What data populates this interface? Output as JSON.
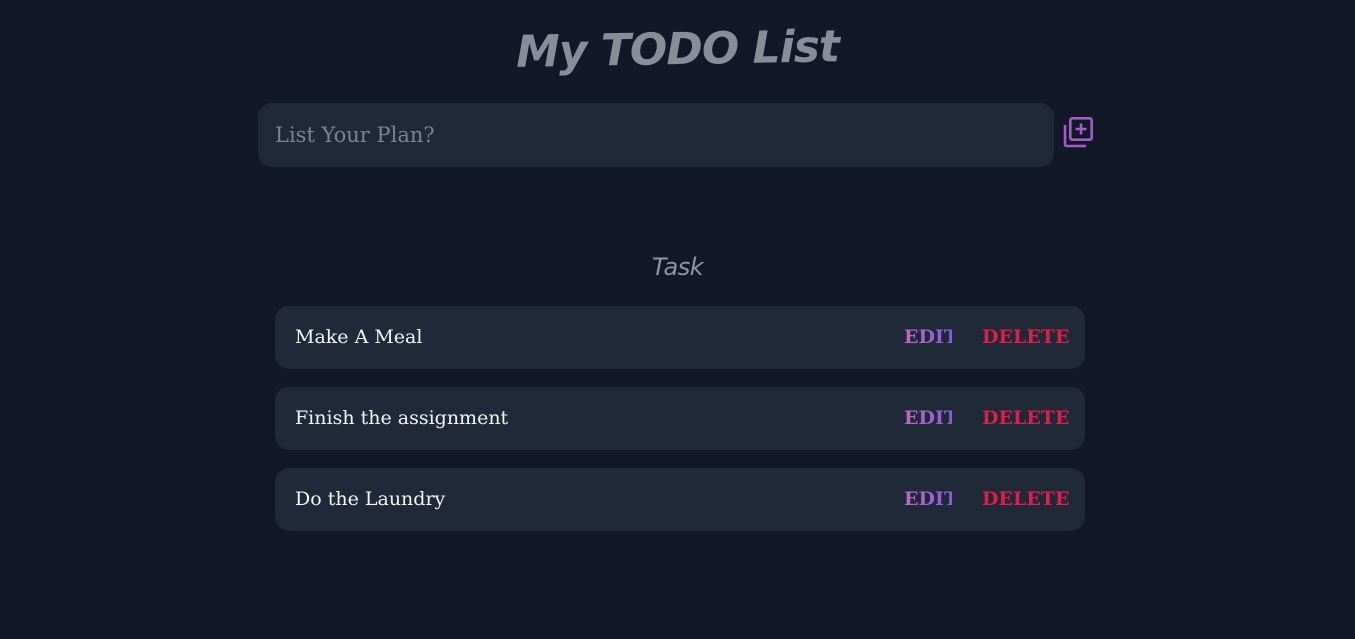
{
  "header": {
    "title": "My TODO List"
  },
  "input": {
    "placeholder": "List Your Plan?",
    "value": ""
  },
  "add_button": {
    "icon": "add-box-icon",
    "color": "#a35ec6"
  },
  "section": {
    "heading": "Task"
  },
  "tasks": [
    {
      "text": "Make A Meal",
      "edit_label": "EDIT",
      "delete_label": "DELETE"
    },
    {
      "text": "Finish the assignment",
      "edit_label": "EDIT",
      "delete_label": "DELETE"
    },
    {
      "text": "Do the Laundry",
      "edit_label": "EDIT",
      "delete_label": "DELETE"
    }
  ],
  "colors": {
    "background": "#121827",
    "card": "#202937",
    "edit": "#a35ec6",
    "delete": "#e01e4c"
  }
}
